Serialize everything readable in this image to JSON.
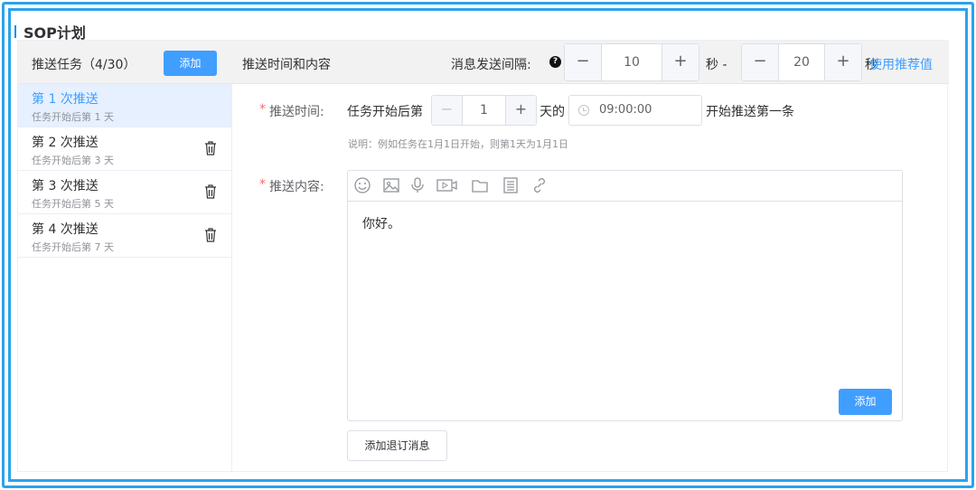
{
  "page_title": "SOP计划",
  "left": {
    "header_label": "推送任务（4/30）",
    "add_button": "添加",
    "tasks": [
      {
        "title": "第 1 次推送",
        "subtitle": "任务开始后第 1 天",
        "active": true
      },
      {
        "title": "第 2 次推送",
        "subtitle": "任务开始后第 3 天"
      },
      {
        "title": "第 3 次推送",
        "subtitle": "任务开始后第 5 天"
      },
      {
        "title": "第 4 次推送",
        "subtitle": "任务开始后第 7 天"
      }
    ]
  },
  "right_header": {
    "section_title": "推送时间和内容",
    "interval_label": "消息发送间隔:",
    "help_icon": "?",
    "min_value": "10",
    "min_unit": "秒 -",
    "max_value": "20",
    "max_unit": "秒",
    "recommend_link": "使用推荐值"
  },
  "stepper_glyphs": {
    "minus": "−",
    "plus": "+"
  },
  "push_time": {
    "label": "推送时间:",
    "prefix": "任务开始后第",
    "day_value": "1",
    "day_suffix": "天的",
    "time_value": "09:00:00",
    "suffix": "开始推送第一条",
    "hint": "说明：例如任务在1月1日开始，则第1天为1月1日"
  },
  "push_content": {
    "label": "推送内容:",
    "toolbar_icons": [
      "emoji-icon",
      "image-icon",
      "microphone-icon",
      "video-icon",
      "folder-icon",
      "document-icon",
      "link-icon"
    ],
    "text": "你好。",
    "add_button": "添加"
  },
  "unsubscribe_button": "添加退订消息",
  "colors": {
    "accent": "#409eff",
    "frame": "#2aa3ec",
    "required": "#f56c6c"
  }
}
